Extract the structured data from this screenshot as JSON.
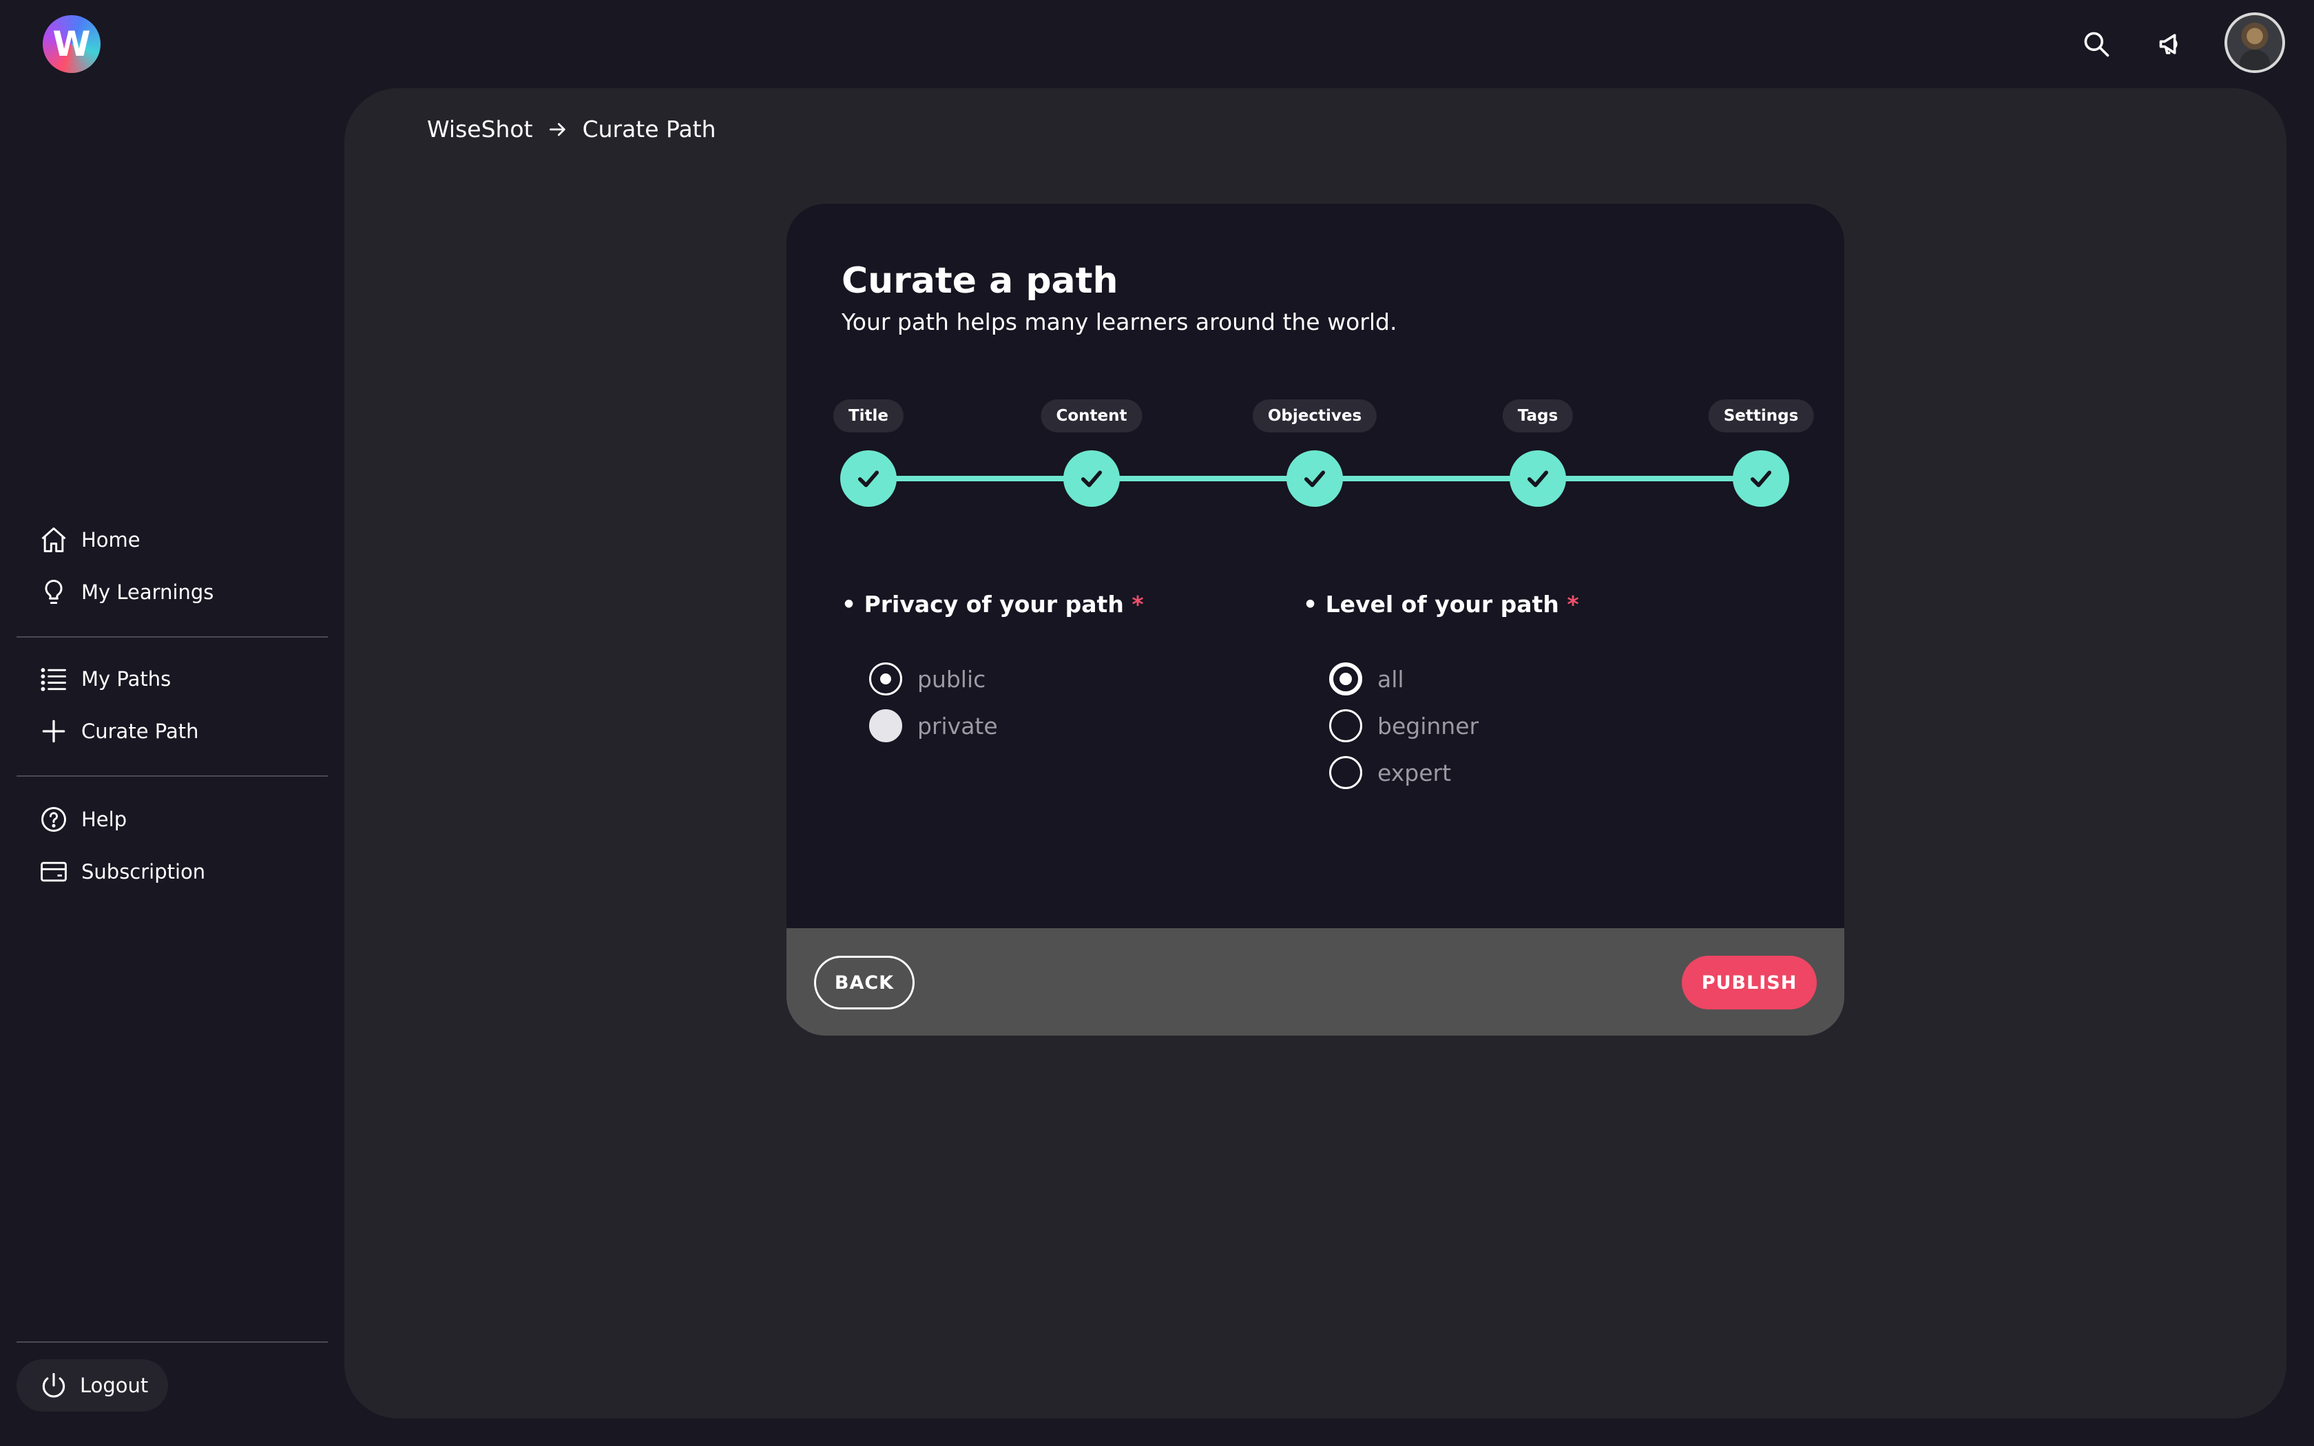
{
  "app": {
    "logo_letter": "W",
    "accent_color": "#6ee7d0",
    "danger_color": "#ee4664"
  },
  "topbar": {
    "icons": [
      "search-icon",
      "megaphone-icon",
      "avatar"
    ]
  },
  "sidebar": {
    "items": [
      {
        "label": "Home",
        "icon": "home-icon"
      },
      {
        "label": "My Learnings",
        "icon": "lightbulb-icon"
      },
      {
        "label": "My Paths",
        "icon": "list-icon"
      },
      {
        "label": "Curate Path",
        "icon": "plus-icon"
      },
      {
        "label": "Help",
        "icon": "help-circle-icon"
      },
      {
        "label": "Subscription",
        "icon": "credit-card-icon"
      }
    ],
    "logout_label": "Logout"
  },
  "breadcrumb": {
    "root": "WiseShot",
    "current": "Curate Path"
  },
  "card": {
    "title": "Curate a path",
    "subtitle": "Your path helps many learners around the world.",
    "steps": [
      {
        "label": "Title",
        "done": true
      },
      {
        "label": "Content",
        "done": true
      },
      {
        "label": "Objectives",
        "done": true
      },
      {
        "label": "Tags",
        "done": true
      },
      {
        "label": "Settings",
        "done": true
      }
    ],
    "privacy": {
      "label": "• Privacy of your path",
      "required_mark": "*",
      "options": [
        "public",
        "private"
      ],
      "selected": "public"
    },
    "level": {
      "label": "• Level of your path",
      "required_mark": "*",
      "options": [
        "all",
        "beginner",
        "expert"
      ],
      "selected": "all"
    },
    "back_label": "BACK",
    "publish_label": "PUBLISH"
  }
}
